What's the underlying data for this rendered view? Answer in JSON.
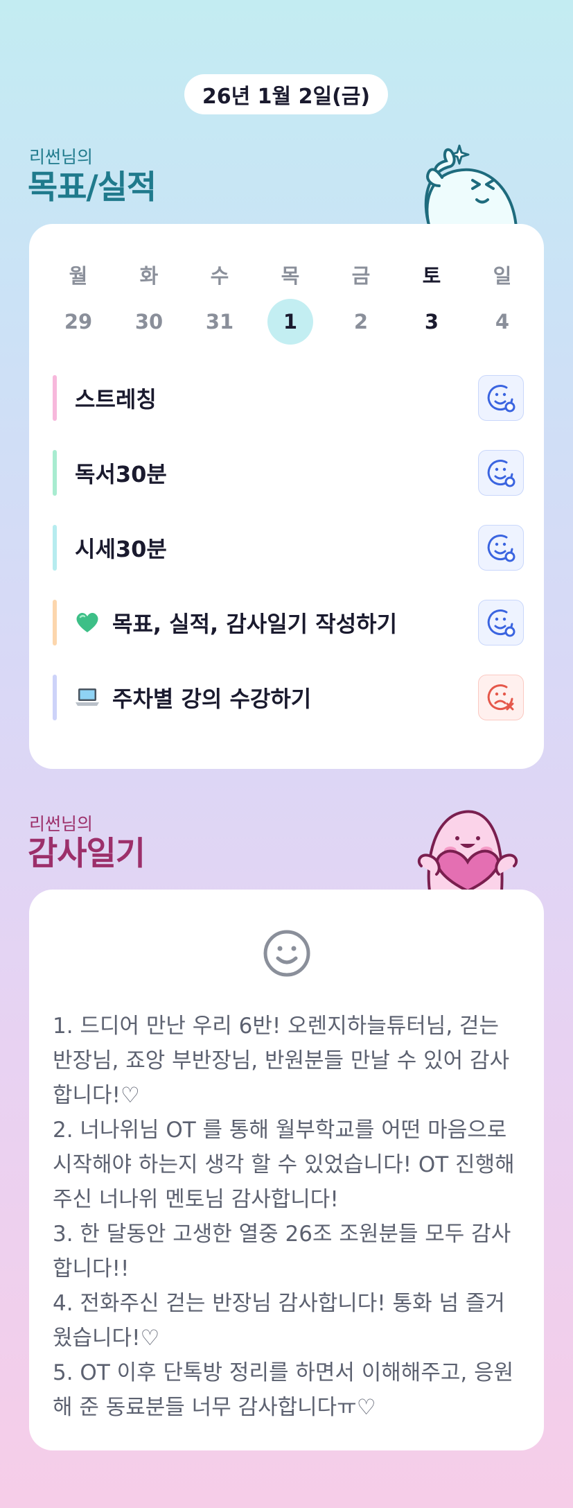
{
  "date": "26년 1월 2일(금)",
  "goals_section": {
    "owner": "리썬님의",
    "title": "목표/실적"
  },
  "week": {
    "days": [
      {
        "weekday": "월",
        "date": "29",
        "selected": false,
        "emphasis": false
      },
      {
        "weekday": "화",
        "date": "30",
        "selected": false,
        "emphasis": false
      },
      {
        "weekday": "수",
        "date": "31",
        "selected": false,
        "emphasis": false
      },
      {
        "weekday": "목",
        "date": "1",
        "selected": true,
        "emphasis": false
      },
      {
        "weekday": "금",
        "date": "2",
        "selected": false,
        "emphasis": false
      },
      {
        "weekday": "토",
        "date": "3",
        "selected": false,
        "emphasis": true
      },
      {
        "weekday": "일",
        "date": "4",
        "selected": false,
        "emphasis": false
      }
    ]
  },
  "goals": [
    {
      "label": "스트레칭",
      "color": "#f7b8dc",
      "emoji": "",
      "status": "done"
    },
    {
      "label": "독서30분",
      "color": "#a8ecd0",
      "emoji": "",
      "status": "done"
    },
    {
      "label": "시세30분",
      "color": "#b6ecef",
      "emoji": "",
      "status": "done"
    },
    {
      "label": "목표, 실적, 감사일기 작성하기",
      "color": "#fcd6ad",
      "emoji": "green-heart",
      "status": "done"
    },
    {
      "label": "주차별 강의 수강하기",
      "color": "#cdd3f9",
      "emoji": "laptop",
      "status": "not-done"
    }
  ],
  "status_colors": {
    "done": "#3a64e0",
    "not_done": "#e5574a"
  },
  "gratitude_section": {
    "owner": "리썬님의",
    "title": "감사일기"
  },
  "diary": {
    "mood_icon": "smile-face-icon",
    "lines": [
      "1. 드디어 만난 우리 6반! 오렌지하늘튜터님, 걷는 반장님, 죠앙 부반장님, 반원분들 만날 수 있어 감사합니다!♡",
      "2. 너나위님 OT 를 통해 월부학교를 어떤 마음으로 시작해야 하는지 생각 할 수 있었습니다! OT 진행해주신 너나위 멘토님 감사합니다!",
      "3. 한 달동안 고생한 열중 26조 조원분들 모두 감사합니다!!",
      "4. 전화주신 걷는 반장님 감사합니다! 통화 넘 즐거웠습니다!♡",
      "5. OT 이후 단톡방 정리를 하면서 이해해주고, 응원해 준 동료분들 너무 감사합니다ㅠ♡"
    ]
  }
}
